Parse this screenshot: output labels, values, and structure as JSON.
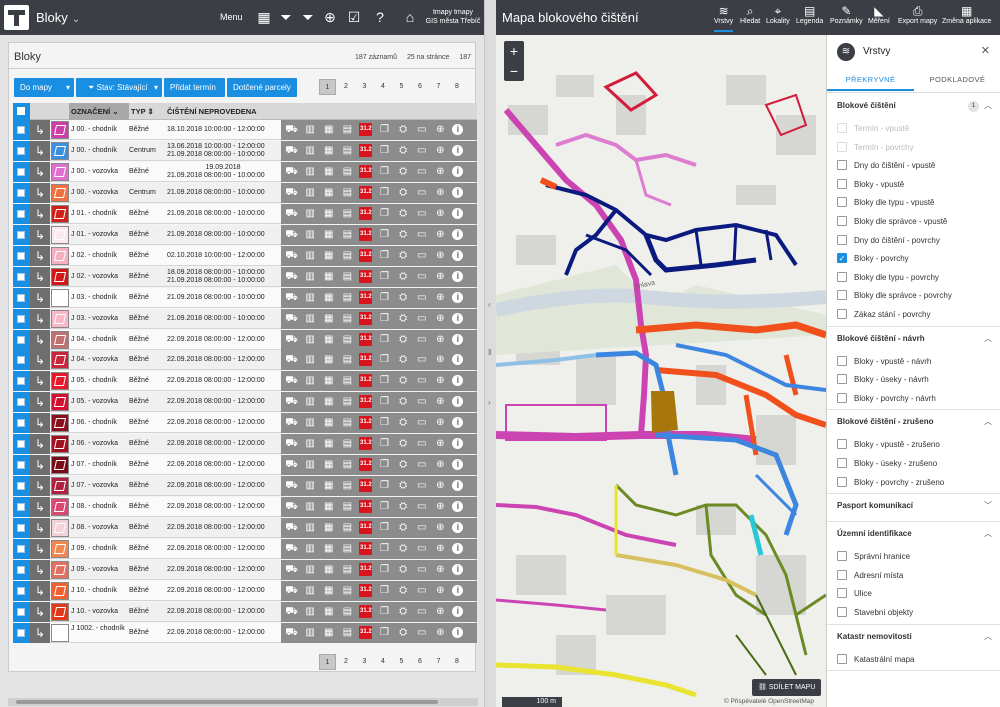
{
  "colors": {
    "topbar": "#3b3f45",
    "accent": "#1a8ee0",
    "danger": "#d8141e"
  },
  "left": {
    "title": "Bloky",
    "menu_label": "Menu",
    "user_name": "tmapy tmapy",
    "user_org": "GIS města Třebíč",
    "icons": [
      "grid-icon",
      "filter-icon",
      "filter-clear-icon",
      "add-icon",
      "select-icon",
      "help-icon",
      "home-icon"
    ]
  },
  "card": {
    "title": "Bloky",
    "record_count": "187 záznamů",
    "per_page": "25 na stránce",
    "total": "187",
    "buttons": {
      "to_map": "Do mapy",
      "state": "Stav: Stávající",
      "add_term": "Přidat termín",
      "parcels": "Dotčené parcely"
    },
    "pages": [
      "1",
      "2",
      "3",
      "4",
      "5",
      "6",
      "7",
      "8"
    ],
    "columns": {
      "name": "OZNAČENÍ",
      "type": "TYP",
      "date": "ČIŠTĚNÍ NEPROVEDENA"
    }
  },
  "rows": [
    {
      "name": "J 00. - chodník",
      "type": "Běžné",
      "dates": [
        "18.10.2018 10:00:00 - 12:00:00"
      ],
      "color": "#cc3fa8"
    },
    {
      "name": "J 00. - chodník",
      "type": "Centrum",
      "dates": [
        "13.06.2018 10:00:00 - 12:00:00",
        "21.09.2018 08:00:00 - 10:00:00"
      ],
      "color": "#3a8fe0"
    },
    {
      "name": "J 00. - vozovka",
      "type": "Běžné",
      "dates": [
        "19.09.2018",
        "21.09.2018 08:00:00 - 10:00:00"
      ],
      "color": "#e070d0"
    },
    {
      "name": "J 00. - vozovka",
      "type": "Centrum",
      "dates": [
        "21.09.2018 08:00:00 - 10:00:00"
      ],
      "color": "#f07040"
    },
    {
      "name": "J 01. - chodník",
      "type": "Běžné",
      "dates": [
        "21.09.2018 08:00:00 - 10:00:00"
      ],
      "color": "#d0201a"
    },
    {
      "name": "J 01. - vozovka",
      "type": "Běžné",
      "dates": [
        "21.09.2018 08:00:00 - 10:00:00"
      ],
      "color": "#fbe8ec"
    },
    {
      "name": "J 02. - chodník",
      "type": "Běžné",
      "dates": [
        "02.10.2018 10:00:00 - 12:00:00"
      ],
      "color": "#f6b0c0"
    },
    {
      "name": "J 02. - vozovka",
      "type": "Běžné",
      "dates": [
        "18.09.2018 08:00:00 - 10:00:00",
        "21.09.2018 08:00:00 - 10:00:00"
      ],
      "color": "#d01818"
    },
    {
      "name": "J 03. - chodník",
      "type": "Běžné",
      "dates": [
        "21.09.2018 08:00:00 - 10:00:00"
      ],
      "color": "#ffffff"
    },
    {
      "name": "J 03. - vozovka",
      "type": "Běžné",
      "dates": [
        "21.09.2018 08:00:00 - 10:00:00"
      ],
      "color": "#f8b8c6"
    },
    {
      "name": "J 04. - chodník",
      "type": "Běžné",
      "dates": [
        "22.09.2018 08:00:00 - 12:00:00"
      ],
      "color": "#c07070"
    },
    {
      "name": "J 04. - vozovka",
      "type": "Běžné",
      "dates": [
        "22.09.2018 08:00:00 - 12:00:00"
      ],
      "color": "#c8263a"
    },
    {
      "name": "J 05. - chodník",
      "type": "Běžné",
      "dates": [
        "22.09.2018 08:00:00 - 12:00:00"
      ],
      "color": "#e8182a"
    },
    {
      "name": "J 05. - vozovka",
      "type": "Běžné",
      "dates": [
        "22.09.2018 08:00:00 - 12:00:00"
      ],
      "color": "#d41030"
    },
    {
      "name": "J 06. - chodník",
      "type": "Běžné",
      "dates": [
        "22.09.2018 08:00:00 - 12:00:00"
      ],
      "color": "#8a1020"
    },
    {
      "name": "J 06. - vozovka",
      "type": "Běžné",
      "dates": [
        "22.09.2018 08:00:00 - 12:00:00"
      ],
      "color": "#a01020"
    },
    {
      "name": "J 07. - chodník",
      "type": "Běžné",
      "dates": [
        "22.09.2018 08:00:00 - 12:00:00"
      ],
      "color": "#7a0c18"
    },
    {
      "name": "J 07. - vozovka",
      "type": "Běžné",
      "dates": [
        "22.09.2018 08:00:00 - 12:00:00"
      ],
      "color": "#b02040"
    },
    {
      "name": "J 08. - chodník",
      "type": "Běžné",
      "dates": [
        "22.09.2018 08:00:00 - 12:00:00"
      ],
      "color": "#d84870"
    },
    {
      "name": "J 08. - vozovka",
      "type": "Běžné",
      "dates": [
        "22.09.2018 08:00:00 - 12:00:00"
      ],
      "color": "#f4d0d8"
    },
    {
      "name": "J 09. - chodník",
      "type": "Běžné",
      "dates": [
        "22.09.2018 08:00:00 - 12:00:00"
      ],
      "color": "#f08850"
    },
    {
      "name": "J 09. - vozovka",
      "type": "Běžné",
      "dates": [
        "22.09.2018 08:00:00 - 12:00:00"
      ],
      "color": "#e07060"
    },
    {
      "name": "J 10. - chodník",
      "type": "Běžné",
      "dates": [
        "22.09.2018 08:00:00 - 12:00:00"
      ],
      "color": "#f06030"
    },
    {
      "name": "J 10. - vozovka",
      "type": "Běžné",
      "dates": [
        "22.09.2018 08:00:00 - 12:00:00"
      ],
      "color": "#e03818"
    },
    {
      "name": "J 1002. - chodník",
      "type": "Běžné",
      "dates": [
        "22.09.2018 08:00:00 - 12:00:00"
      ],
      "color": "#ffffff"
    }
  ],
  "map": {
    "title": "Mapa blokového čištění",
    "toolbar": [
      {
        "label": "Vrstvy",
        "icon": "layers-icon",
        "glyph": "≋",
        "active": true
      },
      {
        "label": "Hledat",
        "icon": "search-icon",
        "glyph": "⌕"
      },
      {
        "label": "Lokality",
        "icon": "location-icon",
        "glyph": "⌖"
      },
      {
        "label": "Legenda",
        "icon": "legend-icon",
        "glyph": "▤"
      },
      {
        "label": "Poznámky",
        "icon": "pencil-icon",
        "glyph": "✎"
      },
      {
        "label": "Měření",
        "icon": "ruler-icon",
        "glyph": "◣"
      },
      {
        "label": "Export mapy",
        "icon": "print-icon",
        "glyph": "⎙"
      },
      {
        "label": "Změna aplikace",
        "icon": "apps-icon",
        "glyph": "▦"
      }
    ],
    "street_label": "Jihlava",
    "share_label": "SDÍLET MAPU",
    "scale_label": "100 m",
    "attribution": "© Přispěvatelé OpenStreetMap"
  },
  "layers": {
    "title": "Vrstvy",
    "tabs": [
      "PŘEKRYVNÉ",
      "PODKLADOVÉ"
    ],
    "groups": [
      {
        "title": "Blokové čištění",
        "count": "1",
        "expanded": true,
        "items": [
          {
            "label": "Termín - vpustě",
            "checked": false,
            "disabled": true
          },
          {
            "label": "Termín - povrchy",
            "checked": false,
            "disabled": true
          },
          {
            "label": "Dny do čištění - vpustě",
            "checked": false
          },
          {
            "label": "Bloky - vpustě",
            "checked": false
          },
          {
            "label": "Bloky dle typu - vpustě",
            "checked": false
          },
          {
            "label": "Bloky dle správce - vpustě",
            "checked": false
          },
          {
            "label": "Dny do čištění - povrchy",
            "checked": false
          },
          {
            "label": "Bloky - povrchy",
            "checked": true
          },
          {
            "label": "Bloky dle typu - povrchy",
            "checked": false
          },
          {
            "label": "Bloky dle správce - povrchy",
            "checked": false
          },
          {
            "label": "Zákaz stání - povrchy",
            "checked": false
          }
        ]
      },
      {
        "title": "Blokové čištění - návrh",
        "expanded": true,
        "items": [
          {
            "label": "Bloky - vpustě - návrh",
            "checked": false
          },
          {
            "label": "Bloky - úseky - návrh",
            "checked": false
          },
          {
            "label": "Bloky - povrchy - návrh",
            "checked": false
          }
        ]
      },
      {
        "title": "Blokové čištění - zrušeno",
        "expanded": true,
        "items": [
          {
            "label": "Bloky - vpustě - zrušeno",
            "checked": false
          },
          {
            "label": "Bloky - úseky - zrušeno",
            "checked": false
          },
          {
            "label": "Bloky - povrchy - zrušeno",
            "checked": false
          }
        ]
      },
      {
        "title": "Pasport komunikací",
        "expanded": false,
        "items": []
      },
      {
        "title": "Územní identifikace",
        "expanded": true,
        "items": [
          {
            "label": "Správní hranice",
            "checked": false
          },
          {
            "label": "Adresní místa",
            "checked": false
          },
          {
            "label": "Ulice",
            "checked": false
          },
          {
            "label": "Stavební objekty",
            "checked": false
          }
        ]
      },
      {
        "title": "Katastr nemovitostí",
        "expanded": true,
        "items": [
          {
            "label": "Katastrální mapa",
            "checked": false
          }
        ]
      }
    ]
  }
}
